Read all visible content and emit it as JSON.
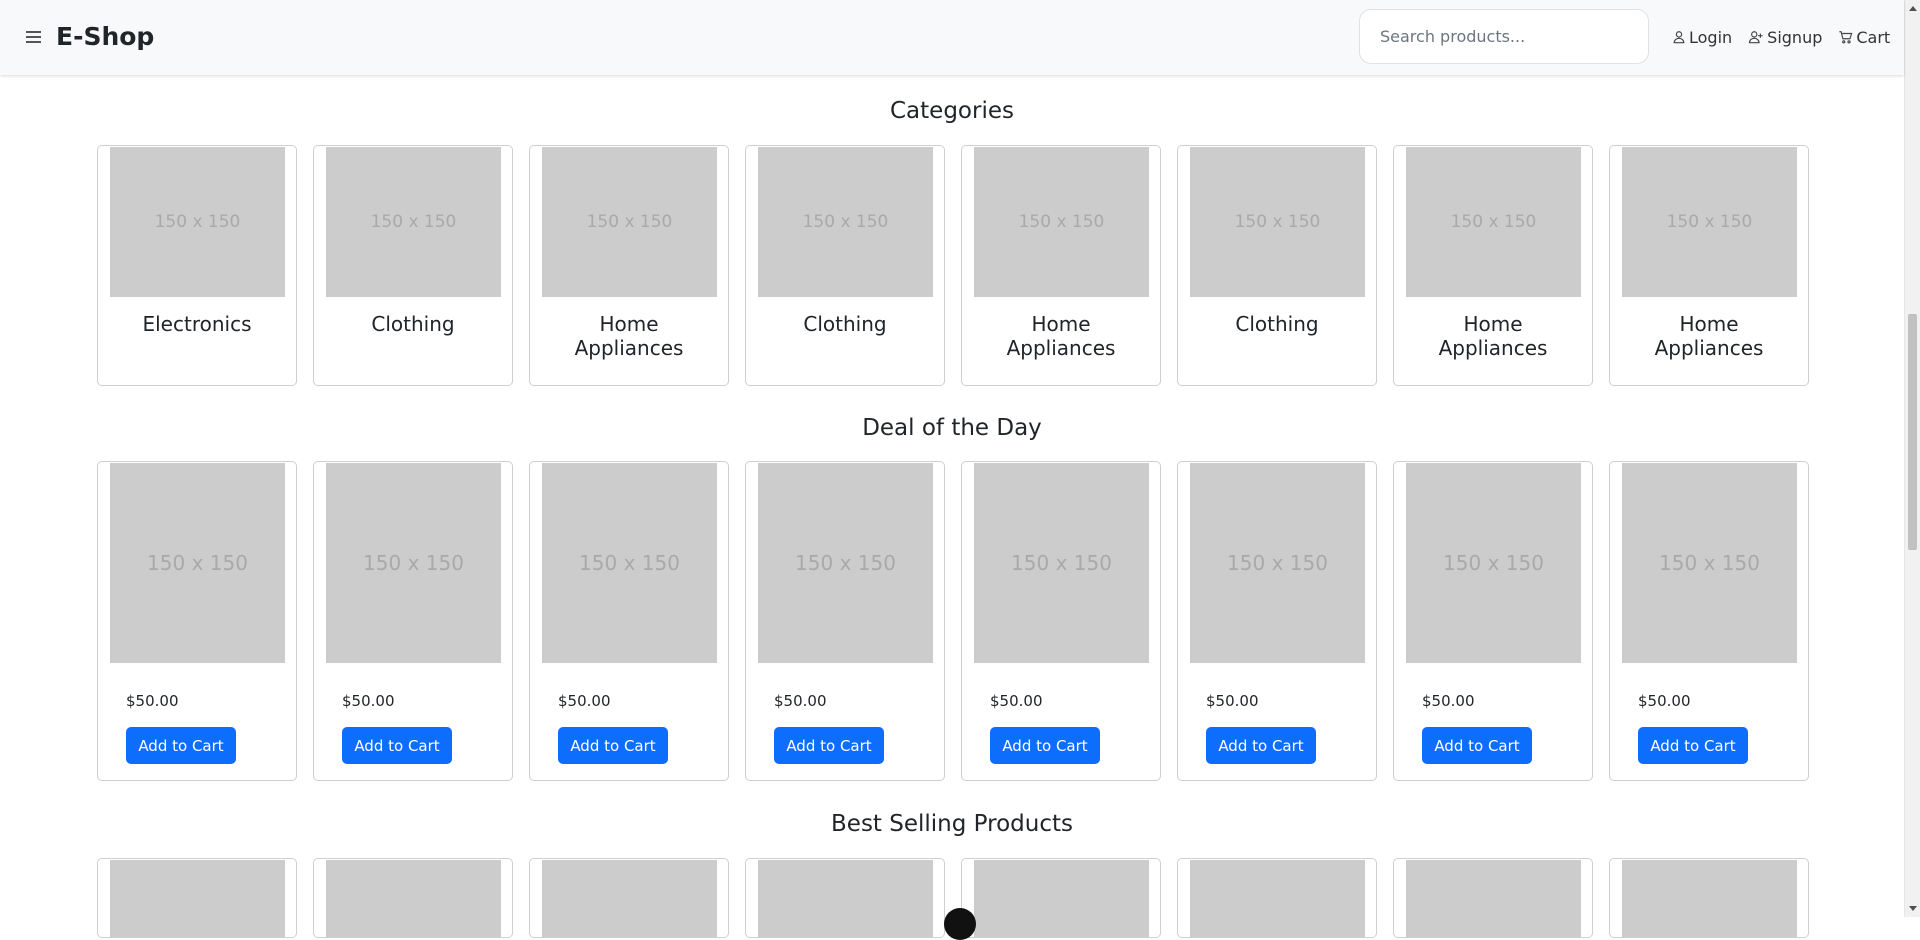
{
  "header": {
    "brand": "E-Shop",
    "search_placeholder": "Search products...",
    "links": [
      {
        "label": "Login",
        "icon": "person-icon"
      },
      {
        "label": "Signup",
        "icon": "person-add-icon"
      },
      {
        "label": "Cart",
        "icon": "cart-icon"
      }
    ]
  },
  "placeholder_text": "150 x 150",
  "categories": {
    "title": "Categories",
    "items": [
      "Electronics",
      "Clothing",
      "Home Appliances",
      "Clothing",
      "Home Appliances",
      "Clothing",
      "Home Appliances",
      "Home Appliances"
    ]
  },
  "deals": {
    "title": "Deal of the Day",
    "button_label": "Add to Cart",
    "items": [
      "$50.00",
      "$50.00",
      "$50.00",
      "$50.00",
      "$50.00",
      "$50.00",
      "$50.00",
      "$50.00"
    ]
  },
  "best_selling": {
    "title": "Best Selling Products",
    "count": 8
  },
  "colors": {
    "primary": "#0d6efd",
    "navbar_bg": "#f8f9fa",
    "placeholder_bg": "#cccccc",
    "placeholder_text": "#a9a9a9"
  }
}
